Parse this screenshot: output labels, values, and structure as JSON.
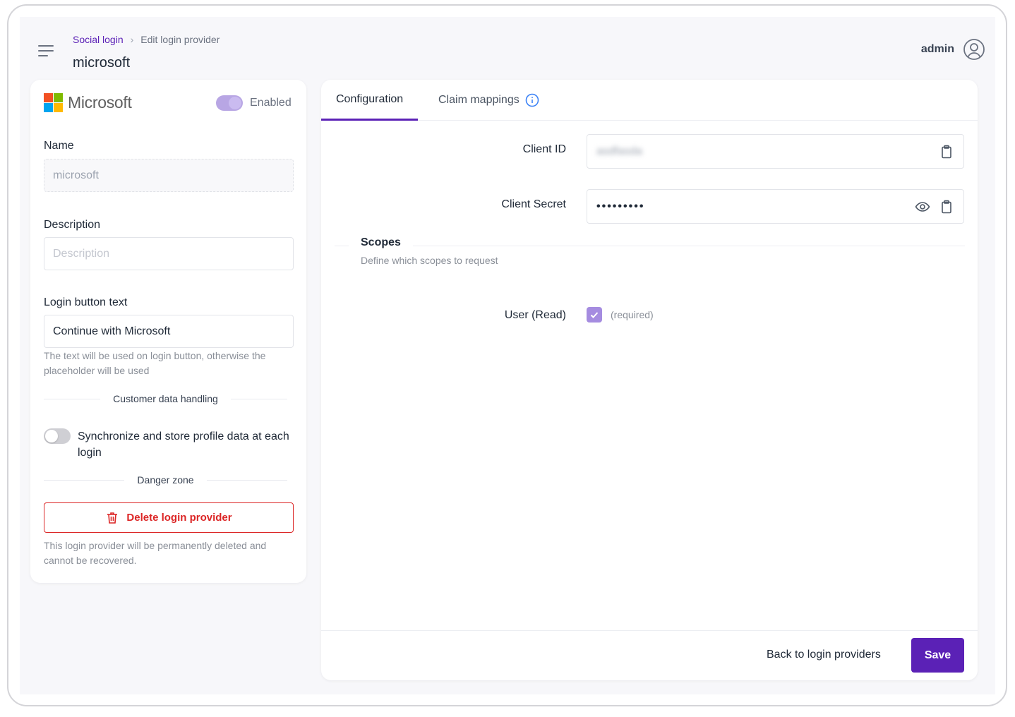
{
  "header": {
    "breadcrumb": {
      "link": "Social login",
      "separator": "›",
      "current": "Edit login provider"
    },
    "title": "microsoft",
    "user": "admin"
  },
  "provider": {
    "brand": "Microsoft",
    "enabled_label": "Enabled",
    "enabled": true
  },
  "form": {
    "name_label": "Name",
    "name_value": "microsoft",
    "description_label": "Description",
    "description_placeholder": "Description",
    "login_text_label": "Login button text",
    "login_text_value": "Continue with Microsoft",
    "login_text_help": "The text will be used on login button, otherwise the placeholder will be used",
    "customer_data_heading": "Customer data handling",
    "sync_label": "Synchronize and store profile data at each login",
    "sync_enabled": false,
    "danger_heading": "Danger zone",
    "delete_label": "Delete login provider",
    "delete_help": "This login provider will be permanently deleted and cannot be recovered."
  },
  "tabs": [
    {
      "label": "Configuration",
      "active": true
    },
    {
      "label": "Claim mappings",
      "active": false,
      "icon": "info-icon"
    }
  ],
  "config": {
    "client_id_label": "Client ID",
    "client_id_value": "asdfasda",
    "client_secret_label": "Client Secret",
    "client_secret_value": "•••••••••",
    "scopes_heading": "Scopes",
    "scopes_sub": "Define which scopes to request",
    "scope_user_label": "User (Read)",
    "scope_user_note": "(required)",
    "scope_user_checked": true
  },
  "footer": {
    "back_label": "Back to login providers",
    "save_label": "Save"
  },
  "colors": {
    "accent": "#5b21b6",
    "danger": "#dc2626",
    "ms_red": "#f25022",
    "ms_green": "#7fba00",
    "ms_blue": "#00a4ef",
    "ms_yellow": "#ffb900"
  }
}
